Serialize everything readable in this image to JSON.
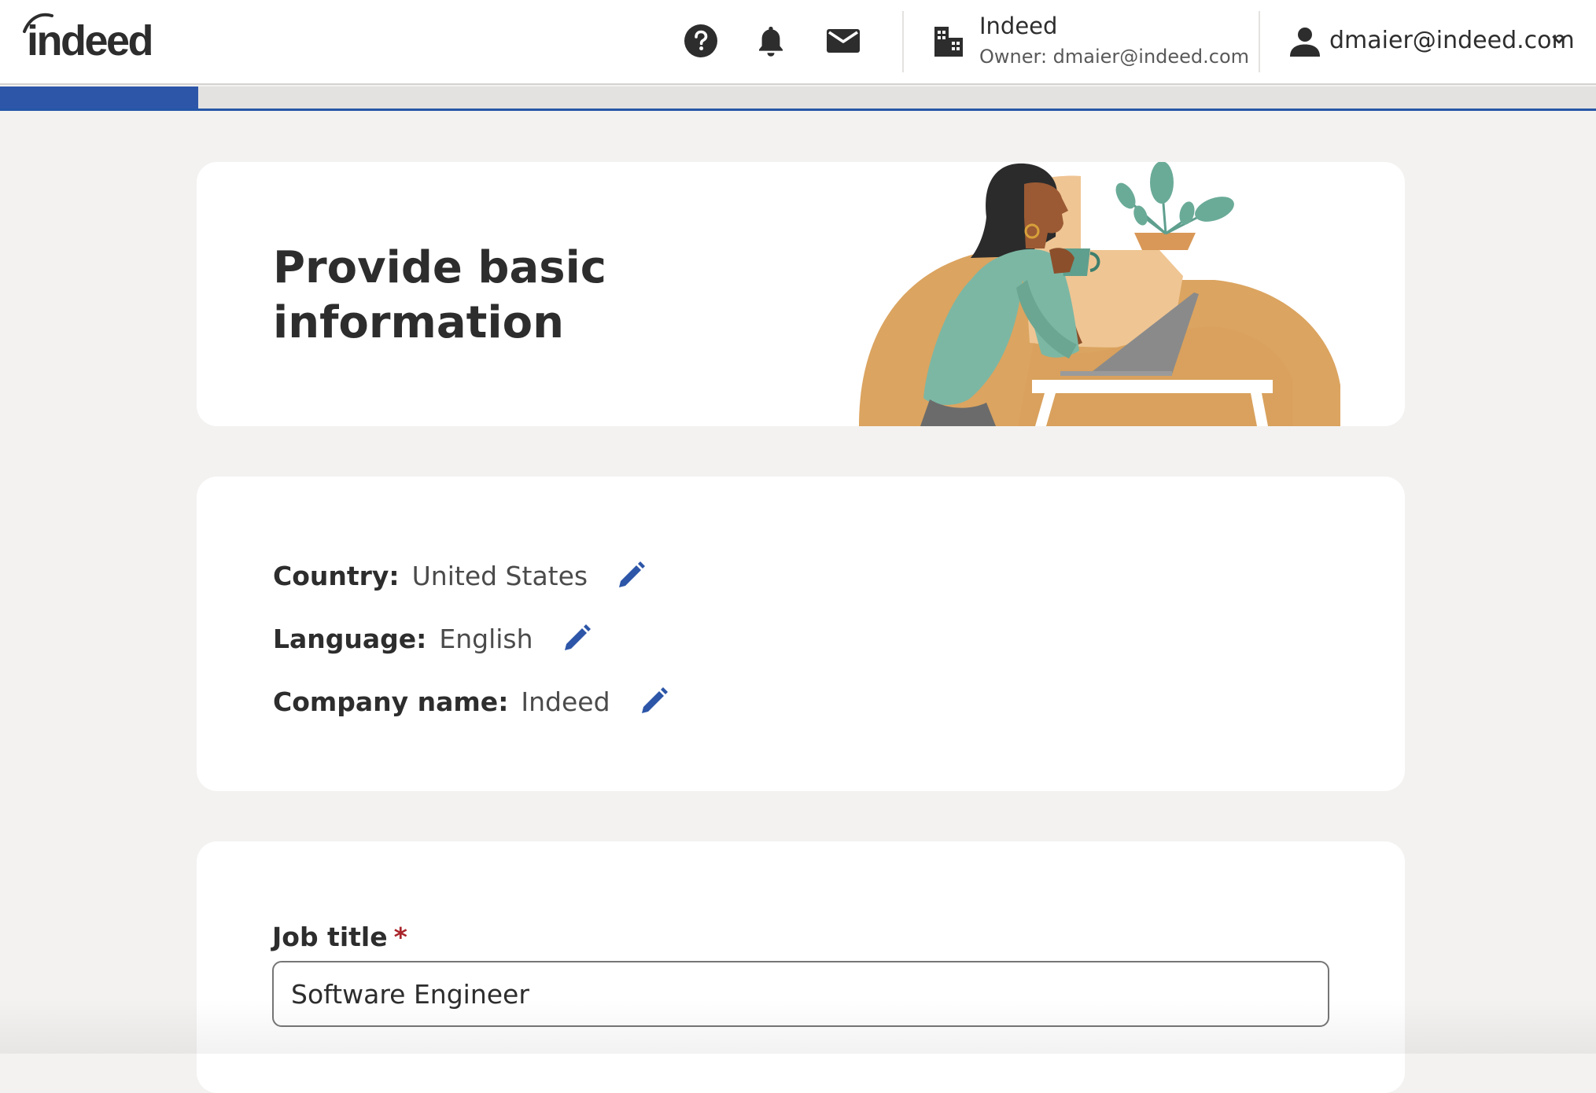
{
  "header": {
    "logo_text": "indeed",
    "company": {
      "name": "Indeed",
      "owner": "Owner: dmaier@indeed.com"
    },
    "user": {
      "email": "dmaier@indeed.com"
    }
  },
  "progress": {
    "fraction": 0.124
  },
  "hero": {
    "title_line1": "Provide basic",
    "title_line2": "information"
  },
  "info": {
    "rows": [
      {
        "label": "Country:",
        "value": "United States"
      },
      {
        "label": "Language:",
        "value": "English"
      },
      {
        "label": "Company name:",
        "value": "Indeed"
      }
    ]
  },
  "job": {
    "label": "Job title",
    "required_mark": "*",
    "value": "Software Engineer"
  },
  "icons": {
    "help": "help-icon",
    "notifications": "bell-icon",
    "messages": "mail-icon",
    "company": "building-icon",
    "user": "user-icon",
    "edit": "pencil-icon",
    "chevron": "chevron-down-icon"
  },
  "colors": {
    "brand_blue": "#2557a7",
    "progress_blue": "#2d56a8",
    "required_red": "#a9252b",
    "background": "#f3f2f1"
  }
}
